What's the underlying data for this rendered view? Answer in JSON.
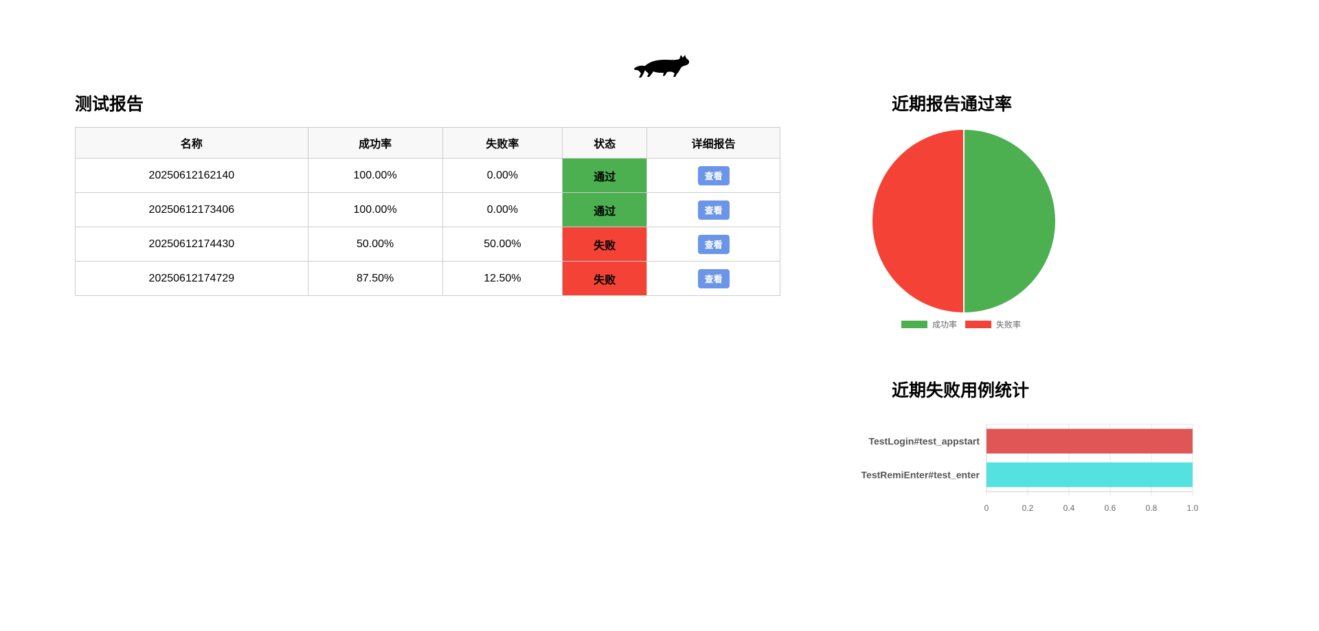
{
  "logo": {
    "icon": "cat-icon"
  },
  "report": {
    "title": "测试报告",
    "columns": [
      "名称",
      "成功率",
      "失败率",
      "状态",
      "详细报告"
    ],
    "rows": [
      {
        "name": "20250612162140",
        "success": "100.00%",
        "fail": "0.00%",
        "status": "通过",
        "status_type": "pass",
        "action": "查看"
      },
      {
        "name": "20250612173406",
        "success": "100.00%",
        "fail": "0.00%",
        "status": "通过",
        "status_type": "pass",
        "action": "查看"
      },
      {
        "name": "20250612174430",
        "success": "50.00%",
        "fail": "50.00%",
        "status": "失败",
        "status_type": "fail",
        "action": "查看"
      },
      {
        "name": "20250612174729",
        "success": "87.50%",
        "fail": "12.50%",
        "status": "失败",
        "status_type": "fail",
        "action": "查看"
      }
    ]
  },
  "colors": {
    "pass": "#4caf50",
    "fail": "#f44336",
    "button": "#6a95e8",
    "bar_red": "#e05555",
    "bar_cyan": "#54e1e0"
  },
  "pie_section": {
    "title": "近期报告通过率"
  },
  "bar_section": {
    "title": "近期失败用例统计"
  },
  "chart_data": [
    {
      "type": "pie",
      "title": "近期报告通过率",
      "legend_position": "bottom",
      "slices": [
        {
          "label": "成功率",
          "value": 50,
          "color": "#4caf50"
        },
        {
          "label": "失败率",
          "value": 50,
          "color": "#f44336"
        }
      ]
    },
    {
      "type": "bar",
      "orientation": "horizontal",
      "title": "近期失败用例统计",
      "categories": [
        "TestLogin#test_appstart",
        "TestRemiEnter#test_enter"
      ],
      "values": [
        1,
        1
      ],
      "colors": [
        "#e05555",
        "#54e1e0"
      ],
      "xlim": [
        0,
        1
      ],
      "xticks": [
        "0",
        "0.2",
        "0.4",
        "0.6",
        "0.8",
        "1.0"
      ],
      "grid": true
    }
  ]
}
